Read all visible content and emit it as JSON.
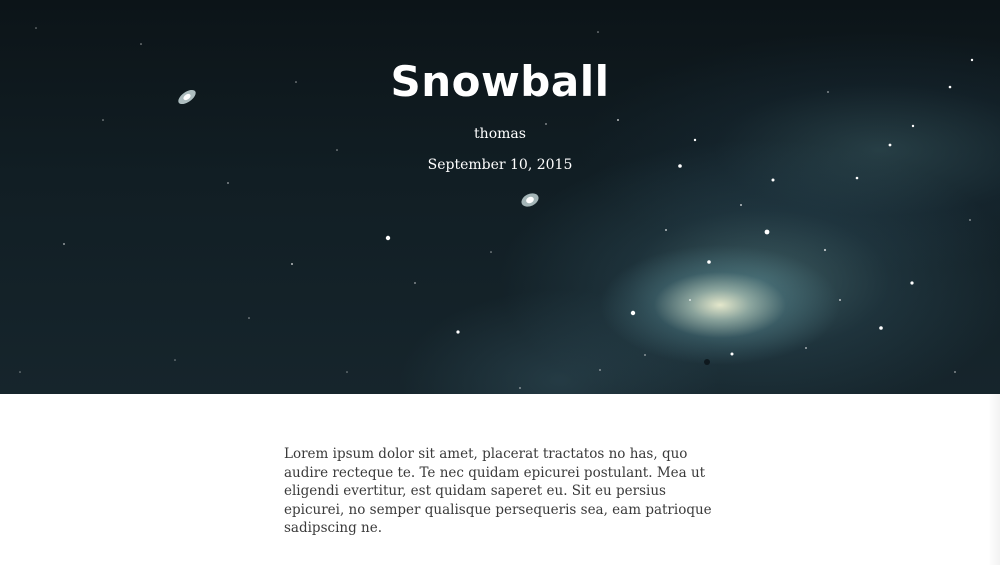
{
  "post": {
    "title": "Snowball",
    "author": "thomas",
    "date": "September 10, 2015",
    "body": "Lorem ipsum dolor sit amet, placerat tractatos no has, quo audire recteque te. Te nec quidam epicurei postulant. Mea ut eligendi evertitur, est quidam saperet eu. Sit eu persius epicurei, no semper qualisque persequeris sea, eam patrioque sadipscing ne."
  },
  "theme": {
    "hero_background": "#111e24",
    "title_color": "#ffffff",
    "body_text_color": "#3a3a3a",
    "page_background": "#ffffff"
  },
  "hero_image": {
    "subject": "galaxy-space-image"
  }
}
